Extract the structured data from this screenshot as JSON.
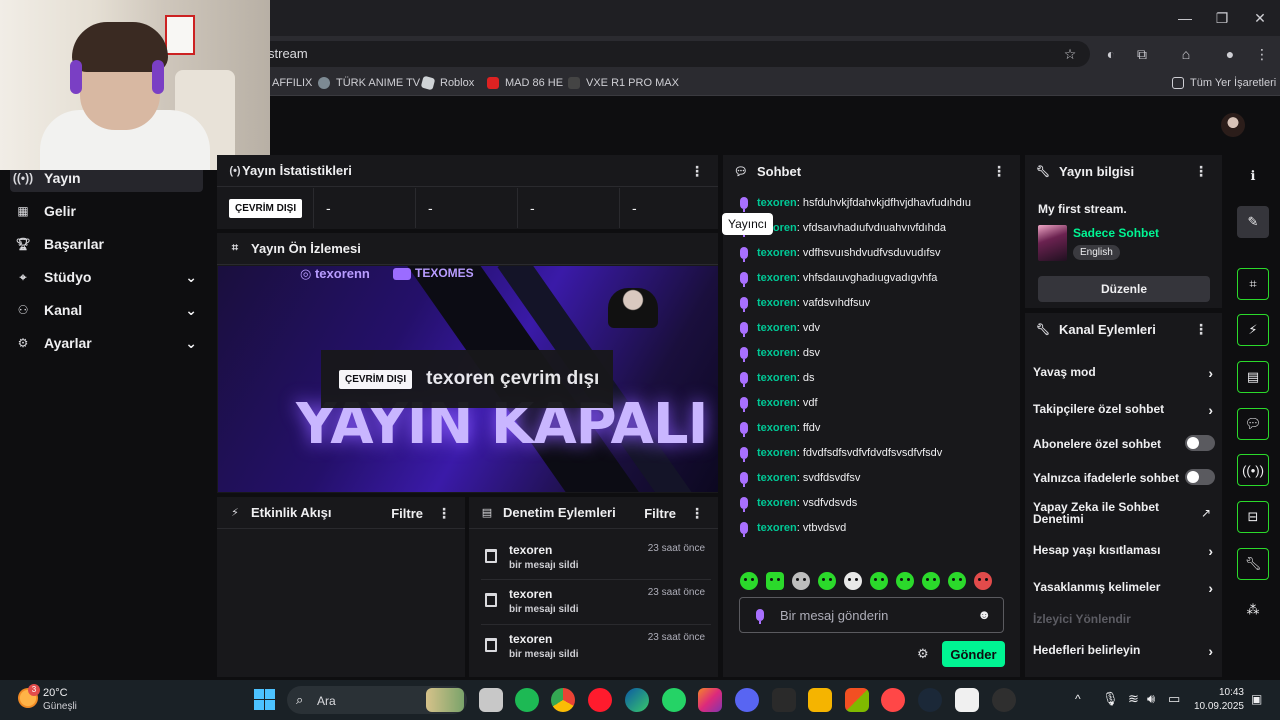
{
  "browser": {
    "url": "stream",
    "bookmarks": [
      "AFFILIX",
      "TÜRK ANIME TV",
      "Roblox",
      "MAD 86 HE",
      "VXE R1 PRO MAX"
    ],
    "all_bookmarks": "Tüm Yer İşaretleri"
  },
  "sidebar": {
    "items": [
      {
        "label": "Yayın",
        "icon": "broadcast-icon",
        "active": true,
        "expandable": false
      },
      {
        "label": "Gelir",
        "icon": "revenue-icon",
        "active": false,
        "expandable": false
      },
      {
        "label": "Başarılar",
        "icon": "trophy-icon",
        "active": false,
        "expandable": false
      },
      {
        "label": "Stüdyo",
        "icon": "studio-icon",
        "active": false,
        "expandable": true
      },
      {
        "label": "Kanal",
        "icon": "channel-icon",
        "active": false,
        "expandable": true
      },
      {
        "label": "Ayarlar",
        "icon": "gear-icon",
        "active": false,
        "expandable": true
      }
    ]
  },
  "stats": {
    "title": "Yayın İstatistikleri",
    "status_badge": "ÇEVRİM DIŞI",
    "values": [
      "-",
      "-",
      "-",
      "-"
    ]
  },
  "preview": {
    "title": "Yayın Ön İzlemesi",
    "overlay_badge": "ÇEVRİM DIŞI",
    "overlay_text": "texoren çevrim dışı",
    "image_text": "YAYIN KAPALI",
    "social_instagram": "texorenn",
    "social_youtube": "TEXOMES"
  },
  "activity": {
    "title": "Etkinlik Akışı",
    "filter": "Filtre"
  },
  "moderation": {
    "title": "Denetim Eylemleri",
    "filter": "Filtre",
    "items": [
      {
        "user": "texoren",
        "action": "bir mesajı sildi",
        "time": "23 saat önce"
      },
      {
        "user": "texoren",
        "action": "bir mesajı sildi",
        "time": "23 saat önce"
      },
      {
        "user": "texoren",
        "action": "bir mesajı sildi",
        "time": "23 saat önce"
      }
    ]
  },
  "chat": {
    "title": "Sohbet",
    "tooltip": "Yayıncı",
    "messages": [
      {
        "user": "texoren",
        "text": ": hsfduhvkjfdahvkjdfhvjdhavfudıhdıu"
      },
      {
        "user": "texoren",
        "text": ": vfdsaıvhadıufvdıuahvıvfdıhda"
      },
      {
        "user": "texoren",
        "text": ": vdfhsvuıshdvudfvsduvudıfsv"
      },
      {
        "user": "texoren",
        "text": ": vhfsdaıuvghadıugvadıgvhfa"
      },
      {
        "user": "texoren",
        "text": ": vafdsvıhdfsuv"
      },
      {
        "user": "texoren",
        "text": ": vdv"
      },
      {
        "user": "texoren",
        "text": ": dsv"
      },
      {
        "user": "texoren",
        "text": ": ds"
      },
      {
        "user": "texoren",
        "text": ": vdf"
      },
      {
        "user": "texoren",
        "text": ": ffdv"
      },
      {
        "user": "texoren",
        "text": ": fdvdfsdfsvdfvfdvdfsvsdfvfsdv"
      },
      {
        "user": "texoren",
        "text": ": svdfdsvdfsv"
      },
      {
        "user": "texoren",
        "text": ": vsdfvdsvds"
      },
      {
        "user": "texoren",
        "text": ": vtbvdsvd"
      }
    ],
    "input_placeholder": "Bir mesaj gönderin",
    "send_label": "Gönder"
  },
  "stream_info": {
    "title": "Yayın bilgisi",
    "stream_title": "My first stream.",
    "category": "Sadece Sohbet",
    "tag": "English",
    "edit_label": "Düzenle"
  },
  "channel_actions": {
    "title": "Kanal Eylemleri",
    "items": [
      {
        "label": "Yavaş mod",
        "control": "arrow"
      },
      {
        "label": "Takipçilere özel sohbet",
        "control": "arrow"
      },
      {
        "label": "Abonelere özel sohbet",
        "control": "toggle"
      },
      {
        "label": "Yalnızca ifadelerle sohbet",
        "control": "toggle"
      },
      {
        "label": "Yapay Zeka ile Sohbet Denetimi",
        "control": "external"
      },
      {
        "label": "Hesap yaşı kısıtlaması",
        "control": "arrow"
      },
      {
        "label": "Yasaklanmış kelimeler",
        "control": "arrow"
      },
      {
        "label": "İzleyici Yönlendir",
        "control": "none"
      },
      {
        "label": "Hedefleri belirleyin",
        "control": "arrow"
      }
    ]
  },
  "taskbar": {
    "weather_temp": "20°C",
    "weather_desc": "Güneşli",
    "weather_badge": "3",
    "search_label": "Ara",
    "time": "10:43",
    "date": "10.09.2025"
  },
  "colors": {
    "accent_green": "#00f593",
    "username": "#00c896",
    "mic_purple": "#a970ff"
  }
}
